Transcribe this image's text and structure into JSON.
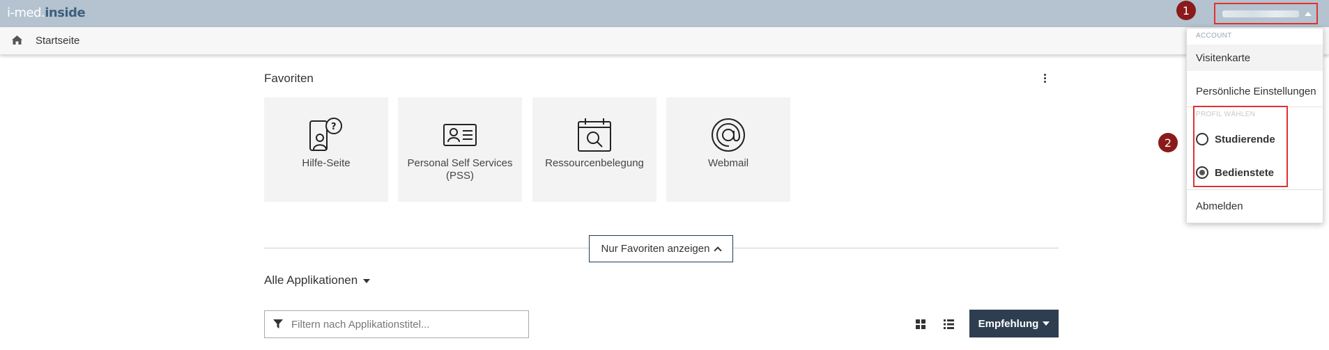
{
  "app": {
    "logo_part1": "i-med.",
    "logo_part2": "inside"
  },
  "colors": {
    "topbar": "#b4c3cf",
    "accent_dark": "#2e3e50",
    "highlight_red": "#e03131",
    "callout": "#8b1a1a"
  },
  "user_menu": {
    "callout_number": "1"
  },
  "breadcrumb": {
    "home_icon": "home-icon",
    "label": "Startseite"
  },
  "favorites": {
    "title": "Favoriten",
    "tiles": [
      {
        "label": "Hilfe-Seite",
        "icon": "help-person-icon"
      },
      {
        "label": "Personal Self Services (PSS)",
        "icon": "id-card-icon"
      },
      {
        "label": "Ressourcenbelegung",
        "icon": "calendar-search-icon"
      },
      {
        "label": "Webmail",
        "icon": "at-sign-icon"
      }
    ],
    "toggle_label": "Nur Favoriten anzeigen"
  },
  "all_apps": {
    "title": "Alle Applikationen",
    "filter_placeholder": "Filtern nach Applikationstitel...",
    "sort_label": "Empfehlung"
  },
  "dropdown": {
    "account_header": "ACCOUNT",
    "items": {
      "business_card": "Visitenkarte",
      "personal_settings": "Persönliche Einstellungen",
      "logout": "Abmelden"
    },
    "profile_header": "PROFIL WÄHLEN",
    "profiles": [
      {
        "label": "Studierende",
        "selected": false
      },
      {
        "label": "Bedienstete",
        "selected": true
      }
    ],
    "callout_number": "2"
  }
}
